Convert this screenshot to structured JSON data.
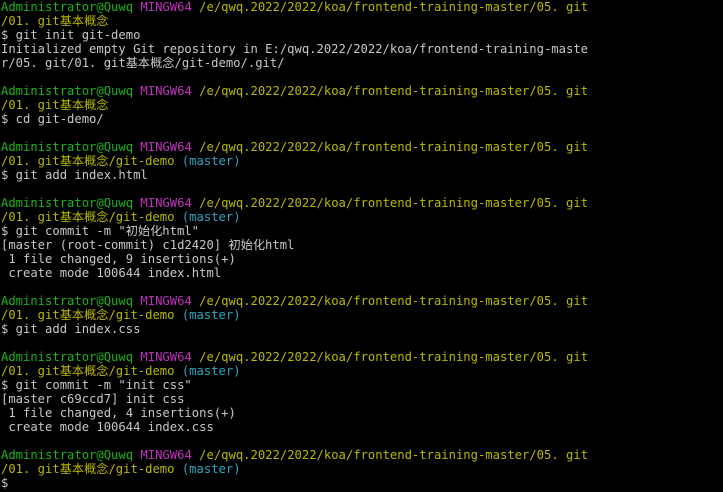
{
  "window": {
    "app": "Git Bash terminal"
  },
  "colors": {
    "background": "#000000",
    "user_host": "#1ab31a",
    "msystem": "#c030c0",
    "path": "#b8b800",
    "branch": "#2fa6c2",
    "output": "#c8c8c8"
  },
  "lines": [
    [
      {
        "t": "Administrator@Quwq",
        "c": "user"
      },
      {
        "t": " "
      },
      {
        "t": "MINGW64",
        "c": "msys"
      },
      {
        "t": " "
      },
      {
        "t": "/e/qwq.2022/2022/koa/frontend-training-master/05. git",
        "c": "path"
      }
    ],
    [
      {
        "t": "/01. git基本概念",
        "c": "path"
      }
    ],
    [
      {
        "t": "$ git init git-demo",
        "c": "prompt"
      }
    ],
    [
      {
        "t": "Initialized empty Git repository in E:/qwq.2022/2022/koa/frontend-training-maste",
        "c": "out"
      }
    ],
    [
      {
        "t": "r/05. git/01. git基本概念/git-demo/.git/",
        "c": "out"
      }
    ],
    [],
    [
      {
        "t": "Administrator@Quwq",
        "c": "user"
      },
      {
        "t": " "
      },
      {
        "t": "MINGW64",
        "c": "msys"
      },
      {
        "t": " "
      },
      {
        "t": "/e/qwq.2022/2022/koa/frontend-training-master/05. git",
        "c": "path"
      }
    ],
    [
      {
        "t": "/01. git基本概念",
        "c": "path"
      }
    ],
    [
      {
        "t": "$ cd git-demo/",
        "c": "prompt"
      }
    ],
    [],
    [
      {
        "t": "Administrator@Quwq",
        "c": "user"
      },
      {
        "t": " "
      },
      {
        "t": "MINGW64",
        "c": "msys"
      },
      {
        "t": " "
      },
      {
        "t": "/e/qwq.2022/2022/koa/frontend-training-master/05. git",
        "c": "path"
      }
    ],
    [
      {
        "t": "/01. git基本概念/git-demo",
        "c": "path"
      },
      {
        "t": " "
      },
      {
        "t": "(master)",
        "c": "branch"
      }
    ],
    [
      {
        "t": "$ git add index.html",
        "c": "prompt"
      }
    ],
    [],
    [
      {
        "t": "Administrator@Quwq",
        "c": "user"
      },
      {
        "t": " "
      },
      {
        "t": "MINGW64",
        "c": "msys"
      },
      {
        "t": " "
      },
      {
        "t": "/e/qwq.2022/2022/koa/frontend-training-master/05. git",
        "c": "path"
      }
    ],
    [
      {
        "t": "/01. git基本概念/git-demo",
        "c": "path"
      },
      {
        "t": " "
      },
      {
        "t": "(master)",
        "c": "branch"
      }
    ],
    [
      {
        "t": "$ git commit -m \"初始化html\"",
        "c": "prompt"
      }
    ],
    [
      {
        "t": "[master (root-commit) c1d2420] 初始化html",
        "c": "out"
      }
    ],
    [
      {
        "t": " 1 file changed, 9 insertions(+)",
        "c": "out"
      }
    ],
    [
      {
        "t": " create mode 100644 index.html",
        "c": "out"
      }
    ],
    [],
    [
      {
        "t": "Administrator@Quwq",
        "c": "user"
      },
      {
        "t": " "
      },
      {
        "t": "MINGW64",
        "c": "msys"
      },
      {
        "t": " "
      },
      {
        "t": "/e/qwq.2022/2022/koa/frontend-training-master/05. git",
        "c": "path"
      }
    ],
    [
      {
        "t": "/01. git基本概念/git-demo",
        "c": "path"
      },
      {
        "t": " "
      },
      {
        "t": "(master)",
        "c": "branch"
      }
    ],
    [
      {
        "t": "$ git add index.css",
        "c": "prompt"
      }
    ],
    [],
    [
      {
        "t": "Administrator@Quwq",
        "c": "user"
      },
      {
        "t": " "
      },
      {
        "t": "MINGW64",
        "c": "msys"
      },
      {
        "t": " "
      },
      {
        "t": "/e/qwq.2022/2022/koa/frontend-training-master/05. git",
        "c": "path"
      }
    ],
    [
      {
        "t": "/01. git基本概念/git-demo",
        "c": "path"
      },
      {
        "t": " "
      },
      {
        "t": "(master)",
        "c": "branch"
      }
    ],
    [
      {
        "t": "$ git commit -m \"init css\"",
        "c": "prompt"
      }
    ],
    [
      {
        "t": "[master c69ccd7] init css",
        "c": "out"
      }
    ],
    [
      {
        "t": " 1 file changed, 4 insertions(+)",
        "c": "out"
      }
    ],
    [
      {
        "t": " create mode 100644 index.css",
        "c": "out"
      }
    ],
    [],
    [
      {
        "t": "Administrator@Quwq",
        "c": "user"
      },
      {
        "t": " "
      },
      {
        "t": "MINGW64",
        "c": "msys"
      },
      {
        "t": " "
      },
      {
        "t": "/e/qwq.2022/2022/koa/frontend-training-master/05. git",
        "c": "path"
      }
    ],
    [
      {
        "t": "/01. git基本概念/git-demo",
        "c": "path"
      },
      {
        "t": " "
      },
      {
        "t": "(master)",
        "c": "branch"
      }
    ],
    [
      {
        "t": "$",
        "c": "prompt"
      }
    ]
  ]
}
